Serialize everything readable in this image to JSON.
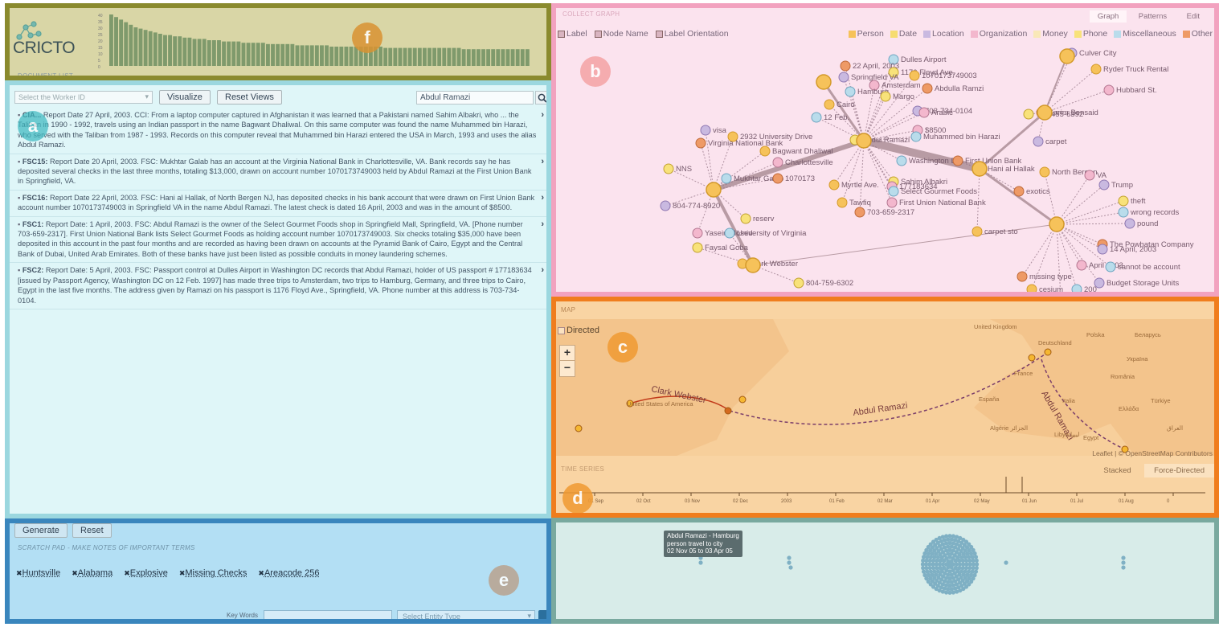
{
  "logo": {
    "text": "CRICTO"
  },
  "frequency": {
    "axis_ticks": [
      "40",
      "35",
      "30",
      "25",
      "20",
      "15",
      "10",
      "5",
      "0"
    ],
    "values": [
      40,
      38,
      36,
      34,
      32,
      30,
      29,
      28,
      27,
      26,
      25,
      24,
      24,
      23,
      23,
      22,
      22,
      21,
      21,
      21,
      20,
      20,
      20,
      19,
      19,
      19,
      19,
      18,
      18,
      18,
      18,
      18,
      17,
      17,
      17,
      17,
      17,
      17,
      16,
      16,
      16,
      16,
      16,
      16,
      16,
      15,
      15,
      15,
      15,
      15,
      15,
      15,
      15,
      15,
      15,
      15,
      14,
      14,
      14,
      14,
      14,
      14,
      14,
      14,
      14,
      14,
      14,
      14,
      14,
      14,
      14,
      14,
      13,
      13,
      13,
      13,
      13,
      13,
      13,
      13,
      13,
      13,
      13,
      13,
      13,
      13
    ]
  },
  "panels": {
    "document_list": "DOCUMENT LIST",
    "scratch_pad": "SCRATCH PAD - MAKE NOTES OF IMPORTANT TERMS",
    "map": "MAP",
    "time_series": "TIME SERIES",
    "badges": {
      "f": "f",
      "a": "a",
      "b": "b",
      "c": "c",
      "d": "d",
      "e": "e"
    }
  },
  "toolbar": {
    "worker_placeholder": "Select the Worker ID",
    "visualize": "Visualize",
    "reset_views": "Reset Views",
    "search_value": "Abdul Ramazi"
  },
  "documents": [
    {
      "id": "CIA...",
      "text": "Report Date 27 April, 2003. CCI: From a laptop computer captured in Afghanistan it was learned that a Pakistani named Sahim Albakri, who ... the Taliban in 1990 - 1992, travels using an Indian passport in the name Bagwant Dhaliwal. On this same computer was found the name Muhammed bin Harazi, who served with the Taliban from 1987 - 1993. Records on this computer reveal that Muhammed bin Harazi entered the USA in March, 1993 and uses the alias Abdul Ramazi."
    },
    {
      "id": "FSC15:",
      "text": "Report Date 20 April, 2003. FSC: Mukhtar Galab has an account at the Virginia National Bank in Charlottesville, VA. Bank records say he has deposited several checks in the last three months, totaling $13,000, drawn on account number 1070173749003 held by Abdul Ramazi at the First Union Bank in Springfield, VA."
    },
    {
      "id": "FSC16:",
      "text": "Report Date 22 April, 2003. FSC: Hani al Hallak, of North Bergen NJ, has deposited checks in his bank account that were drawn on First Union Bank account number 1070173749003 in Springfield VA in the name Abdul Ramazi. The latest check is dated 16 April, 2003 and was in the amount of $8500."
    },
    {
      "id": "FSC1:",
      "text": "Report Date: 1 April, 2003. FSC: Abdul Ramazi is the owner of the Select Gourmet Foods shop in Springfield Mall, Springfield, VA. [Phone number 703-659-2317]. First Union National Bank lists Select Gourmet Foods as holding account number 1070173749003. Six checks totaling $35,000 have been deposited in this account in the past four months and are recorded as having been drawn on accounts at the Pyramid Bank of Cairo, Egypt and the Central Bank of Dubai, United Arab Emirates. Both of these banks have just been listed as possible conduits in money laundering schemes."
    },
    {
      "id": "FSC2:",
      "text": "Report Date: 5 April, 2003. FSC: Passport control at Dulles Airport in Washington DC records that Abdul Ramazi, holder of US passport # 177183634 [issued by Passport Agency, Washington DC on 12 Feb. 1997] has made three trips to Amsterdam, two trips to Hamburg, Germany, and three trips to Cairo, Egypt in the last five months. The address given by Ramazi on his passport is 1176 Floyd Ave., Springfield, VA. Phone number at this address is 703-734-0104."
    }
  ],
  "scratch": {
    "generate": "Generate",
    "reset": "Reset",
    "tags": [
      "Huntsville",
      "Alabama",
      "Explosive",
      "Missing Checks",
      "Areacode 256"
    ],
    "keywords_label": "Key Words",
    "entity_placeholder": "Select Entity Type"
  },
  "graph": {
    "title": "COLLECT GRAPH",
    "tabs": [
      "Graph",
      "Patterns",
      "Edit"
    ],
    "options": [
      "Label",
      "Node Name",
      "Label Orientation"
    ],
    "legend": [
      {
        "label": "Person",
        "color": "#f6c25a"
      },
      {
        "label": "Date",
        "color": "#f6dc70"
      },
      {
        "label": "Location",
        "color": "#c9b9e0"
      },
      {
        "label": "Organization",
        "color": "#f3b7cd"
      },
      {
        "label": "Money",
        "color": "#f9e8b8"
      },
      {
        "label": "Phone",
        "color": "#f8e27a"
      },
      {
        "label": "Miscellaneous",
        "color": "#b9dceb"
      },
      {
        "label": "Other",
        "color": "#ee9a66"
      }
    ],
    "labels": [
      "Culver City",
      "Ryder Truck Rental",
      "Hubbard St.",
      "Dulles Airport",
      "22 April, 2003",
      "1176 Floyd Ave.",
      "Springfield VA",
      "1070173749003",
      "Amsterdam",
      "Hamburg",
      "Abdulla Ramzi",
      "Margo",
      "703-734-0104",
      "Cairo",
      "Arabic",
      "12 Feb.",
      "Karim Bensaid",
      "732-455-6392",
      "visa",
      "2932 University Drive",
      "$8500",
      "Muhammed bin Harazi",
      "Virginia National Bank",
      "Abdul Ramazi",
      "carpet",
      "Bagwant Dhaliwal",
      "Charlottesville",
      "Washington DC",
      "First Union Bank",
      "NNS",
      "Hani al Hallak",
      "North Bergen",
      "VA",
      "Mukhtar Galab",
      "1070173",
      "Sahim Albakri",
      "Trump",
      "Myrtle Ave.",
      "177183634",
      "Select Gourmet Foods",
      "exotics",
      "theft",
      "804-774-8920",
      "Tawfiq",
      "First Union National Bank",
      "wrong records",
      "703-659-2317",
      "reserv",
      "pound",
      "carpet sto",
      "Yasein Mosed",
      "University of Virginia",
      "The Powhatan Company",
      "Faysal Goba",
      "14 April, 2003",
      "Clark Webster",
      "April 2003",
      "cannot be account",
      "missing type",
      "804-759-6302",
      "Budget Storage Units",
      "cesium",
      "27 April, 2003",
      "200"
    ]
  },
  "map": {
    "directed": "Directed",
    "zoom_in": "+",
    "zoom_out": "−",
    "attribution": "Leaflet | © OpenStreetMap Contributors",
    "route_labels": [
      "Clark Webster",
      "Abdul Ramazi",
      "Abdul Ramazi"
    ],
    "places": [
      "United States of America",
      "United Kingdom",
      "Deutschland",
      "Polska",
      "Беларусь",
      "Україна",
      "France",
      "România",
      "España",
      "Italia",
      "Ελλάδα",
      "Türkiye",
      "Algérie الجزائر",
      "Libya ليبيا",
      "Egypt",
      "العراق"
    ]
  },
  "timeseries": {
    "tabs": [
      "Stacked",
      "Force-Directed"
    ],
    "ticks": [
      "01 Sep",
      "02 Oct",
      "03 Nov",
      "02 Dec",
      "2003",
      "01 Feb",
      "02 Mar",
      "01 Apr",
      "02 May",
      "01 Jun",
      "01 Jul",
      "01 Aug",
      "0"
    ]
  },
  "events": {
    "tooltip": [
      "Abdul Ramazi - Hamburg",
      "person travel to city",
      "02 Nov 05 to 03 Apr 05"
    ]
  }
}
